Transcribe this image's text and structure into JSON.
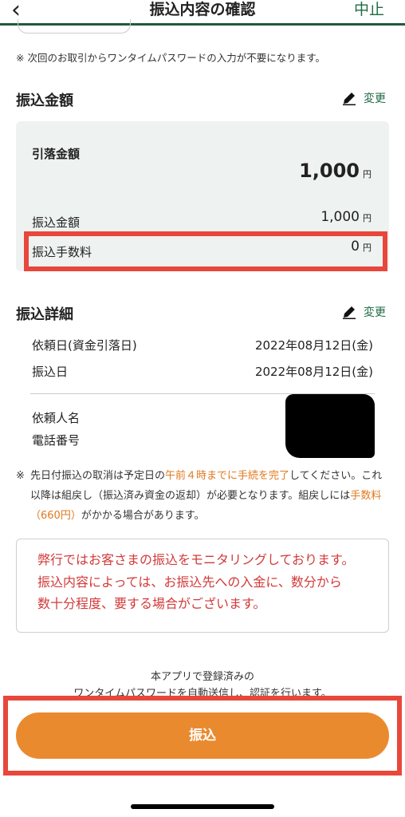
{
  "header": {
    "back_icon": "chevron-left-icon",
    "title": "振込内容の確認",
    "cancel": "中止"
  },
  "note_top": "※ 次回のお取引からワンタイムパスワードの入力が不要になります。",
  "amount_section": {
    "title": "振込金額",
    "edit_label": "変更",
    "debit_label": "引落金額",
    "debit_value": "1,000",
    "transfer_label": "振込金額",
    "transfer_value": "1,000",
    "fee_label": "振込手数料",
    "fee_value": "0",
    "currency": "円"
  },
  "detail_section": {
    "title": "振込詳細",
    "edit_label": "変更",
    "request_date_label": "依頼日(資金引落日)",
    "request_date_value": "2022年08月12日(金)",
    "transfer_date_label": "振込日",
    "transfer_date_value": "2022年08月12日(金)",
    "requester_label": "依頼人名",
    "phone_label": "電話番号"
  },
  "note_bottom": {
    "mark": "※",
    "p1": "先日付振込の取消は予定日の",
    "p1_highlight": "午前４時までに手続を完了",
    "p2": "してください。これ以降は組戻し（振込済み資金の返却）が必要となります。組戻しには",
    "p2_highlight": "手数料（660円）",
    "p3": "がかかる場合があります。"
  },
  "warning": {
    "line1": "弊行ではお客さまの振込をモニタリングしております。",
    "line2": "振込内容によっては、お振込先への入金に、数分から",
    "line3": "数十分程度、要する場合がございます。"
  },
  "otp_info": {
    "line1": "本アプリで登録済みの",
    "line2": "ワンタイムパスワードを自動送信し、認証を行います。"
  },
  "submit_button": "振込",
  "colors": {
    "accent_green": "#1f6b45",
    "button_orange": "#ea8a2f",
    "highlight_red": "#e8473b",
    "warning_red": "#d23a3a"
  }
}
